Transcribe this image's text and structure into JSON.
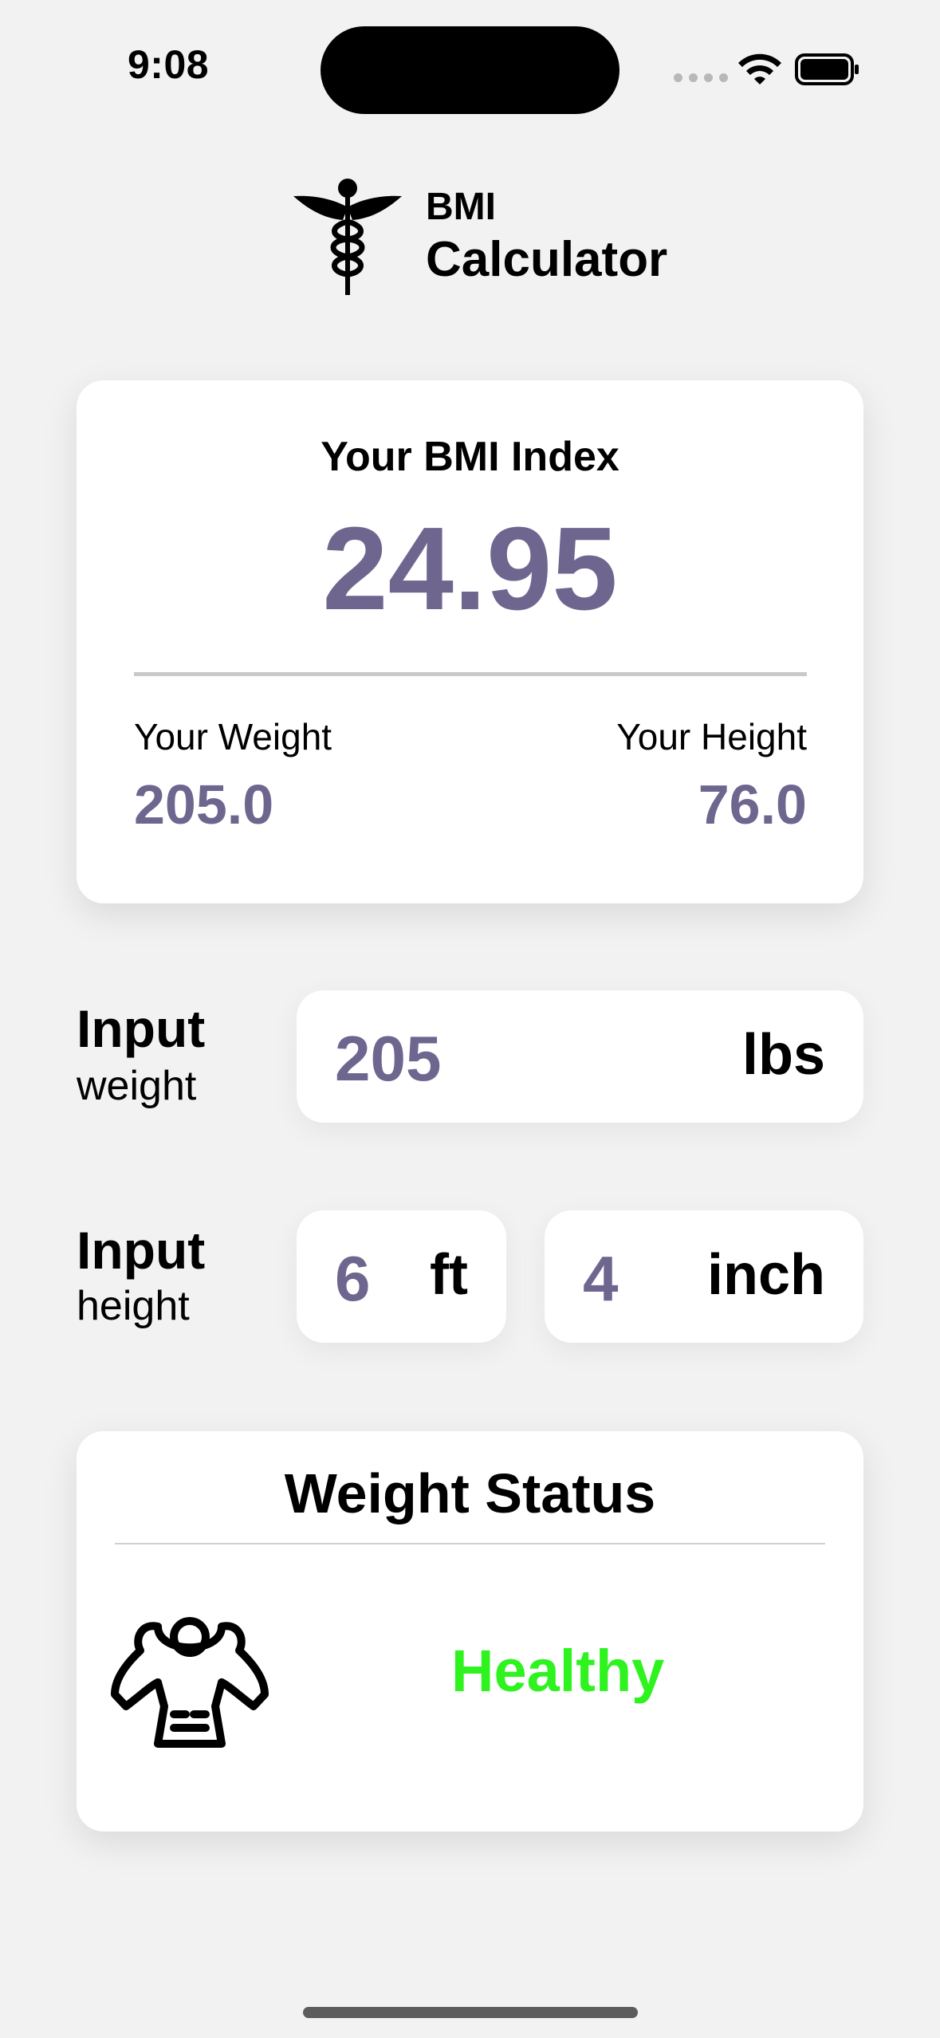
{
  "status_bar": {
    "time": "9:08"
  },
  "header": {
    "brand_line1": "BMI",
    "brand_line2": "Calculator",
    "logo_icon": "caduceus-icon"
  },
  "result": {
    "title": "Your BMI Index",
    "bmi": "24.95",
    "weight_label": "Your Weight",
    "weight_value": "205.0",
    "height_label": "Your Height",
    "height_value": "76.0"
  },
  "inputs": {
    "weight_label_strong": "Input",
    "weight_label_sub": "weight",
    "weight_value": "205",
    "weight_unit": "lbs",
    "height_label_strong": "Input",
    "height_label_sub": "height",
    "feet_value": "6",
    "feet_unit": "ft",
    "inch_value": "4",
    "inch_unit": "inch"
  },
  "status": {
    "title": "Weight Status",
    "value": "Healthy",
    "icon": "muscle-icon"
  },
  "colors": {
    "accent": "#6e668f",
    "status_good": "#2ef31f",
    "background": "#f3f2f3"
  }
}
